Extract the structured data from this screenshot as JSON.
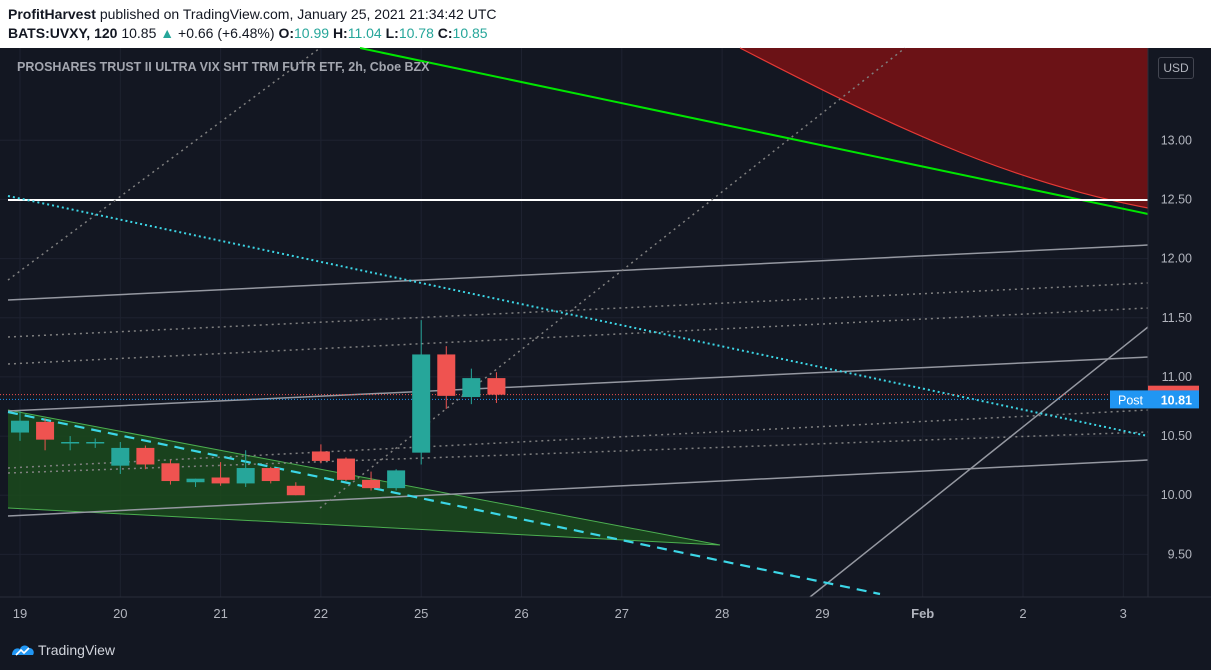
{
  "header": {
    "author": "ProfitHarvest",
    "published_text": "published on TradingView.com, January 25, 2021 21:34:42 UTC",
    "symbol": "BATS:UVXY, 120",
    "last": "10.85",
    "change": "+0.66 (+6.48%)",
    "o_label": "O:",
    "o_value": "10.99",
    "h_label": "H:",
    "h_value": "11.04",
    "l_label": "L:",
    "l_value": "10.78",
    "c_label": "C:",
    "c_value": "10.85"
  },
  "chart_title": "PROSHARES TRUST II ULTRA VIX SHT TRM FUTR ETF, 2h, Cboe BZX",
  "currency_button": "USD",
  "footer": {
    "brand": "TradingView"
  },
  "colors": {
    "up": "#26a69a",
    "down": "#ef5350",
    "background": "#131722",
    "post_badge": "#2196f3"
  },
  "chart_data": {
    "type": "candlestick",
    "title": "PROSHARES TRUST II ULTRA VIX SHT TRM FUTR ETF, 2h, Cboe BZX",
    "y_axis": {
      "min": 9.14,
      "max": 13.78,
      "ticks": [
        "9.50",
        "10.00",
        "10.50",
        "11.00",
        "11.50",
        "12.00",
        "12.50",
        "13.00"
      ]
    },
    "x_axis": {
      "ticks": [
        {
          "label": "19",
          "t": 0
        },
        {
          "label": "20",
          "t": 1
        },
        {
          "label": "21",
          "t": 2
        },
        {
          "label": "22",
          "t": 3
        },
        {
          "label": "25",
          "t": 4
        },
        {
          "label": "26",
          "t": 5
        },
        {
          "label": "27",
          "t": 6
        },
        {
          "label": "28",
          "t": 7
        },
        {
          "label": "29",
          "t": 8
        },
        {
          "label": "Feb",
          "t": 9
        },
        {
          "label": "2",
          "t": 10
        },
        {
          "label": "3",
          "t": 11
        }
      ]
    },
    "candles": [
      {
        "t": 0.0,
        "o": 10.53,
        "h": 10.71,
        "l": 10.46,
        "c": 10.63
      },
      {
        "t": 0.25,
        "o": 10.62,
        "h": 10.65,
        "l": 10.38,
        "c": 10.47
      },
      {
        "t": 0.5,
        "o": 10.45,
        "h": 10.5,
        "l": 10.38,
        "c": 10.45
      },
      {
        "t": 0.75,
        "o": 10.45,
        "h": 10.48,
        "l": 10.4,
        "c": 10.45
      },
      {
        "t": 1.0,
        "o": 10.25,
        "h": 10.45,
        "l": 10.18,
        "c": 10.4
      },
      {
        "t": 1.25,
        "o": 10.4,
        "h": 10.42,
        "l": 10.22,
        "c": 10.26
      },
      {
        "t": 1.5,
        "o": 10.27,
        "h": 10.3,
        "l": 10.09,
        "c": 10.12
      },
      {
        "t": 1.75,
        "o": 10.11,
        "h": 10.14,
        "l": 10.07,
        "c": 10.14
      },
      {
        "t": 2.0,
        "o": 10.15,
        "h": 10.28,
        "l": 10.08,
        "c": 10.1
      },
      {
        "t": 2.25,
        "o": 10.1,
        "h": 10.38,
        "l": 10.07,
        "c": 10.23
      },
      {
        "t": 2.5,
        "o": 10.23,
        "h": 10.24,
        "l": 10.1,
        "c": 10.12
      },
      {
        "t": 2.75,
        "o": 10.08,
        "h": 10.11,
        "l": 10.0,
        "c": 10.0
      },
      {
        "t": 3.0,
        "o": 10.37,
        "h": 10.43,
        "l": 10.27,
        "c": 10.29
      },
      {
        "t": 3.25,
        "o": 10.31,
        "h": 10.32,
        "l": 10.12,
        "c": 10.13
      },
      {
        "t": 3.5,
        "o": 10.13,
        "h": 10.2,
        "l": 10.04,
        "c": 10.06
      },
      {
        "t": 3.75,
        "o": 10.06,
        "h": 10.22,
        "l": 10.04,
        "c": 10.21
      },
      {
        "t": 4.0,
        "o": 10.36,
        "h": 11.48,
        "l": 10.26,
        "c": 11.19
      },
      {
        "t": 4.25,
        "o": 11.19,
        "h": 11.26,
        "l": 10.73,
        "c": 10.84
      },
      {
        "t": 4.5,
        "o": 10.83,
        "h": 11.07,
        "l": 10.77,
        "c": 10.99
      },
      {
        "t": 4.75,
        "o": 10.99,
        "h": 11.04,
        "l": 10.78,
        "c": 10.85
      }
    ],
    "last_price": "10.85",
    "post_label": "Post",
    "post_price": "10.81"
  }
}
